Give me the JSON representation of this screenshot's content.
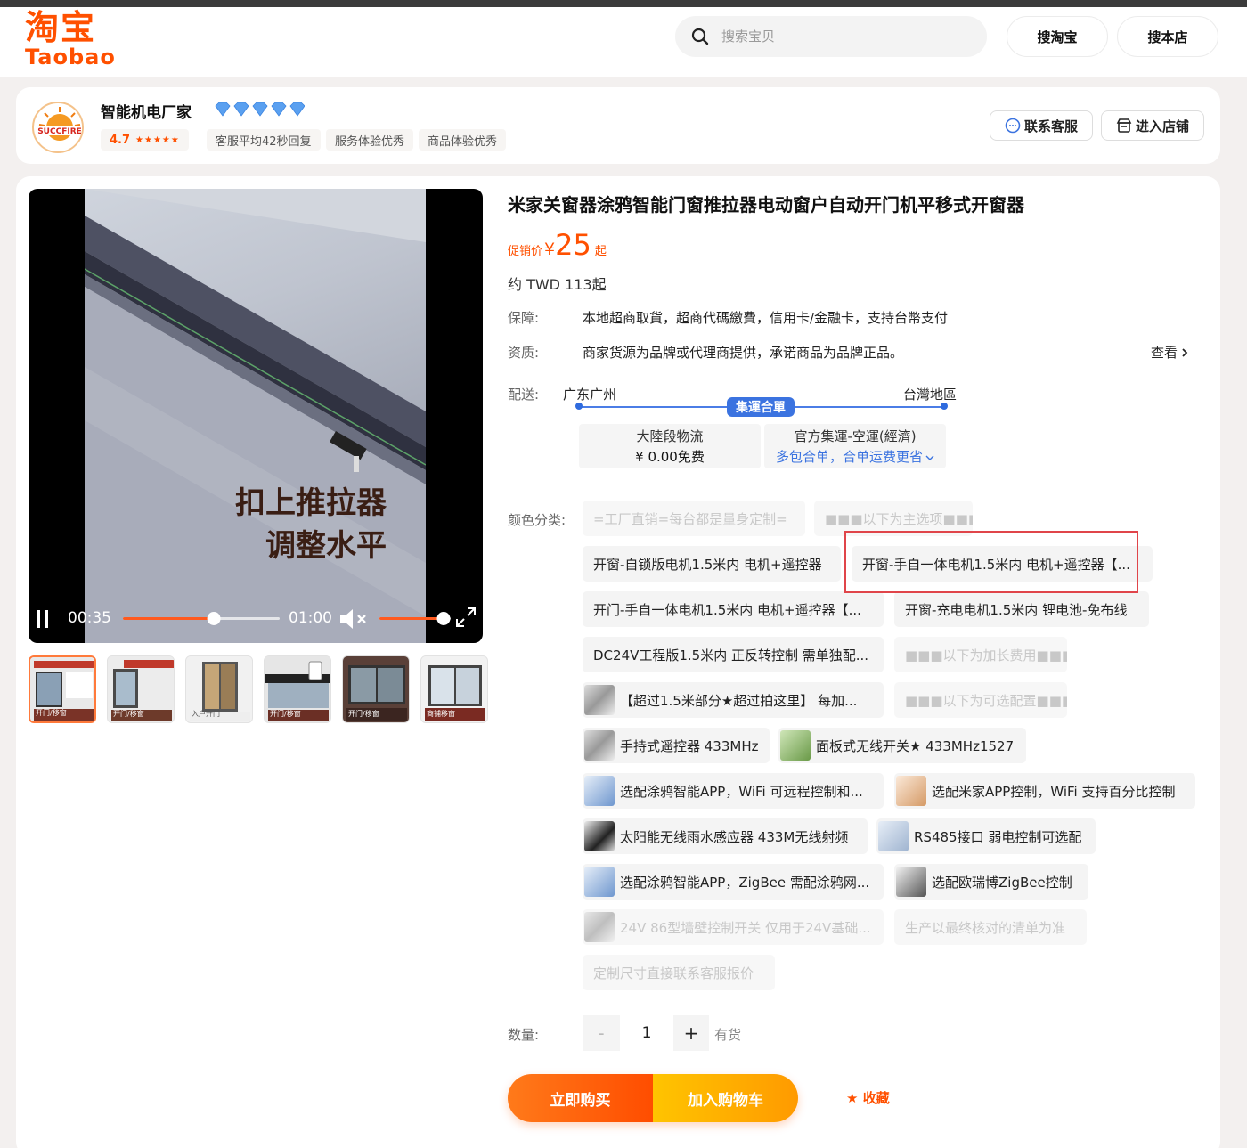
{
  "header": {
    "logo_cn": "淘宝",
    "logo_en": "Taobao",
    "search_placeholder": "搜索宝贝",
    "search_taobao": "搜淘宝",
    "search_store": "搜本店"
  },
  "shop": {
    "name": "智能机电厂家",
    "logo_text": "SUCCFIRE",
    "rating": "4.7",
    "tags": [
      "客服平均42秒回复",
      "服务体验优秀",
      "商品体验优秀"
    ],
    "contact": "联系客服",
    "enter": "进入店铺"
  },
  "video": {
    "caption_line1": "扣上推拉器",
    "caption_line2": "调整水平",
    "current_time": "00:35",
    "duration": "01:00",
    "progress": 0.58,
    "volume": 0.95
  },
  "thumbs": [
    {
      "label": "开门/移窗"
    },
    {
      "label": "开门/移窗"
    },
    {
      "label": "入户开门"
    },
    {
      "label": "开门/移窗"
    },
    {
      "label": "开门/移窗"
    },
    {
      "label": "商铺移窗"
    }
  ],
  "product": {
    "title": "米家关窗器涂鸦智能门窗推拉器电动窗户自动开门机平移式开窗器",
    "price_label": "促销价",
    "currency": "¥",
    "price": "25",
    "price_suffix": "起",
    "twd": "约 TWD 113起",
    "guarantee_label": "保障:",
    "guarantee": "本地超商取貨，超商代碼繳費，信用卡/金融卡，支持台幣支付",
    "quality_label": "资质:",
    "quality": "商家货源为品牌或代理商提供，承诺商品为品牌正品。",
    "view": "查看",
    "ship_label": "配送:",
    "ship_from": "广东广州",
    "ship_to": "台灣地區",
    "ship_badge": "集運合單",
    "ship_box1_l1": "大陸段物流",
    "ship_box1_l2": "¥ 0.00免费",
    "ship_box2_l1": "官方集運-空運(經濟)",
    "ship_box2_l2": "多包合单，合单运费更省",
    "color_label": "颜色分类:",
    "options": [
      "=工厂直销=每台都是量身定制=",
      "■■■以下为主选项■■■",
      "开窗-自锁版电机1.5米内 电机+遥控器",
      "开窗-手自一体电机1.5米内 电机+遥控器【...",
      "开门-手自一体电机1.5米内 电机+遥控器【...",
      "开窗-充电电机1.5米内 锂电池-免布线",
      "DC24V工程版1.5米内 正反转控制 需单独配...",
      "■■■以下为加长费用■■■",
      "【超过1.5米部分★超过拍这里】 每加...",
      "■■■以下为可选配置■■■",
      "手持式遥控器 433MHz",
      "面板式无线开关★ 433MHz1527",
      "选配涂鸦智能APP，WiFi 可远程控制和...",
      "选配米家APP控制，WiFi 支持百分比控制",
      "太阳能无线雨水感应器 433M无线射频",
      "RS485接口 弱电控制可选配",
      "选配涂鸦智能APP，ZigBee 需配涂鸦网...",
      "选配欧瑞博ZigBee控制",
      "24V 86型墙壁控制开关 仅用于24V基础...",
      "生产以最终核对的清单为准",
      "定制尺寸直接联系客服报价"
    ],
    "qty_label": "数量:",
    "qty_minus": "-",
    "qty_value": "1",
    "qty_plus": "+",
    "stock": "有货",
    "buy_now": "立即购买",
    "add_cart": "加入购物车",
    "favorite": "收藏"
  },
  "colors": {
    "brand": "#ff5000",
    "ship_blue": "#3b73e0",
    "highlight_red": "#e0454a"
  }
}
